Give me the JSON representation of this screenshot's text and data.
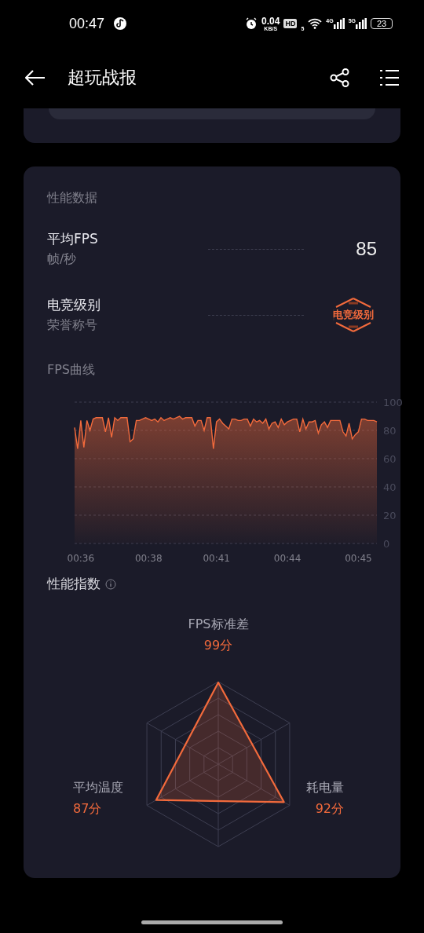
{
  "status_bar": {
    "time": "00:47",
    "net_speed": "0.04",
    "net_unit": "KB/S",
    "hd": "HD",
    "wifi_sub": "5",
    "sim1": "4G",
    "sim2": "5G",
    "battery": "23"
  },
  "header": {
    "title": "超玩战报"
  },
  "performance": {
    "title": "性能数据",
    "rows": [
      {
        "kind": "number",
        "label": "平均FPS",
        "sub": "帧/秒",
        "value": "85"
      },
      {
        "kind": "badge",
        "label": "电竞级别",
        "sub": "荣誉称号",
        "value": "电竞级别"
      }
    ],
    "fps_title": "FPS曲线",
    "chart_data": {
      "type": "line",
      "ylim": [
        0,
        100
      ],
      "yticks": [
        0,
        20,
        40,
        60,
        80,
        100
      ],
      "grid": true,
      "categories": [
        null,
        null,
        "00:36",
        null,
        null,
        null,
        null,
        null,
        null,
        null,
        null,
        null,
        null,
        null,
        null,
        null,
        null,
        null,
        null,
        null,
        null,
        null,
        null,
        null,
        "00:38",
        null,
        null,
        null,
        null,
        null,
        null,
        null,
        null,
        null,
        null,
        null,
        null,
        null,
        null,
        null,
        null,
        null,
        null,
        null,
        null,
        null,
        "00:41",
        null,
        null,
        null,
        null,
        null,
        null,
        null,
        null,
        null,
        null,
        null,
        null,
        null,
        null,
        null,
        null,
        null,
        null,
        null,
        null,
        null,
        null,
        "00:44",
        null,
        null,
        null,
        null,
        null,
        null,
        null,
        null,
        null,
        null,
        null,
        null,
        null,
        null,
        null,
        null,
        null,
        null,
        null,
        null,
        null,
        null,
        "00:45",
        null,
        null,
        null,
        null,
        null,
        null
      ],
      "series": [
        {
          "color": "#f26a3c",
          "values": [
            82,
            67,
            87,
            68,
            87,
            80,
            88,
            89,
            89,
            89,
            79,
            89,
            75,
            89,
            87,
            89,
            89,
            89,
            72,
            74,
            87,
            87,
            88,
            89,
            88,
            87,
            88,
            86,
            89,
            87,
            88,
            89,
            88,
            89,
            90,
            88,
            89,
            89,
            89,
            83,
            87,
            87,
            80,
            89,
            89,
            67,
            86,
            88,
            85,
            83,
            81,
            88,
            88,
            87,
            87,
            88,
            88,
            83,
            88,
            86,
            87,
            85,
            88,
            81,
            85,
            86,
            82,
            88,
            84,
            86,
            87,
            88,
            88,
            79,
            88,
            81,
            86,
            86,
            87,
            78,
            84,
            86,
            82,
            87,
            87,
            87,
            87,
            79,
            76,
            85,
            74,
            77,
            79,
            88,
            88,
            87,
            87,
            87,
            86
          ]
        }
      ]
    },
    "index_title": "性能指数",
    "radar": [
      {
        "label": "FPS标准差",
        "score": "99分"
      },
      {
        "label": "平均温度",
        "score": "87分"
      },
      {
        "label": "耗电量",
        "score": "92分"
      }
    ]
  }
}
